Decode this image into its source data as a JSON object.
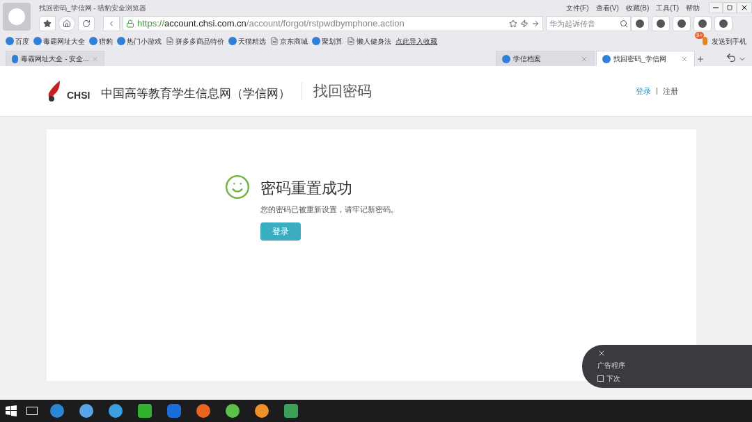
{
  "browser": {
    "title": "找回密码_学信网 - 猎豹安全浏览器",
    "menu": [
      "文件(F)",
      "查看(V)",
      "收藏(B)",
      "工具(T)",
      "帮助"
    ],
    "address": {
      "scheme": "https://",
      "host": "account.chsi.com.cn",
      "path": "/account/forgot/rstpwdbymphone.action"
    },
    "search": {
      "placeholder": "华为起诉传音"
    },
    "notification_badge": "9+",
    "bookmarks": [
      {
        "label": "百度",
        "kind": "site"
      },
      {
        "label": "毒霸网址大全",
        "kind": "site"
      },
      {
        "label": "猎豹",
        "kind": "site"
      },
      {
        "label": "热门小游戏",
        "kind": "site"
      },
      {
        "label": "拼多多商品特价",
        "kind": "page"
      },
      {
        "label": "天猫精选",
        "kind": "site"
      },
      {
        "label": "京东商城",
        "kind": "page"
      },
      {
        "label": "聚划算",
        "kind": "site"
      },
      {
        "label": "懒人健身法",
        "kind": "page"
      },
      {
        "label": "点此导入收藏",
        "kind": "link"
      }
    ],
    "send_to_phone": "发送到手机",
    "tabs": [
      {
        "label": "毒霸网址大全 - 安全...",
        "selected": false
      },
      {
        "label": "学信档案",
        "selected": false
      },
      {
        "label": "找回密码_学信网",
        "selected": true
      }
    ]
  },
  "header": {
    "logo": "CHSI",
    "site_name": "中国高等教育学生信息网（学信网）",
    "page_title": "找回密码",
    "links": [
      "登录",
      "注册"
    ]
  },
  "result": {
    "title": "密码重置成功",
    "message": "您的密码已被重新设置，请牢记新密码。",
    "button": "登录"
  },
  "ad_popup": {
    "label": "广告程序",
    "checkbox": {
      "label": "下次",
      "checked": false
    }
  }
}
